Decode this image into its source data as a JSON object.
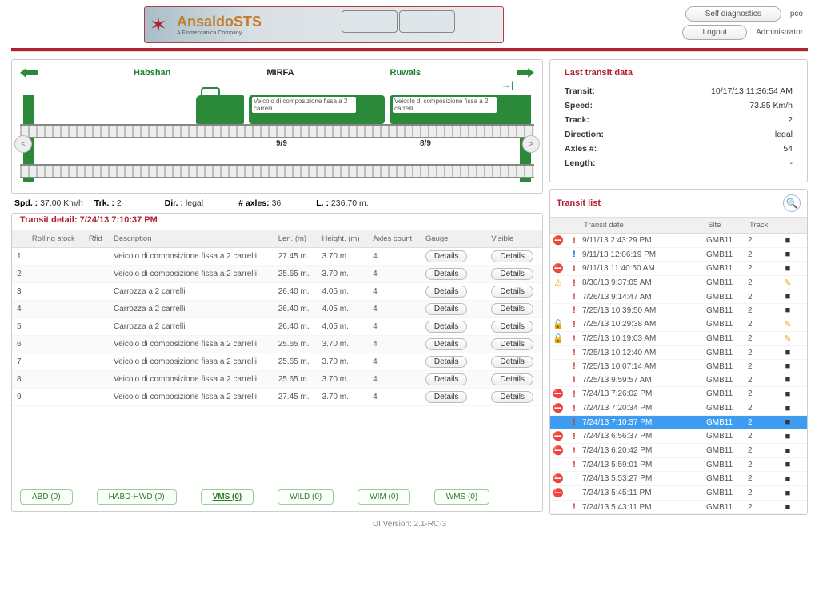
{
  "header": {
    "logo_main": "Ansaldo",
    "logo_suffix": "STS",
    "logo_sub": "A Finmeccanica Company",
    "self_diag": "Self diagnostics",
    "logout": "Logout",
    "user": "pco",
    "role": "Administrator"
  },
  "diagram": {
    "left_dest": "Habshan",
    "center": "MIRFA",
    "right_dest": "Ruwais",
    "wagon_label": "Veicolo di composizione fissa a 2 carrelli",
    "axle_a": "9/9",
    "axle_b": "8/9",
    "nav_l": "<",
    "nav_r": ">"
  },
  "summary": {
    "spd_l": "Spd. :",
    "spd_v": "37.00 Km/h",
    "trk_l": "Trk. :",
    "trk_v": "2",
    "dir_l": "Dir. :",
    "dir_v": "legal",
    "axles_l": "# axles:",
    "axles_v": "36",
    "len_l": "L. :",
    "len_v": "236.70 m."
  },
  "detail_title": "Transit detail: 7/24/13 7:10:37 PM",
  "veh_cols": [
    "",
    "Rolling stock",
    "Rfid",
    "Description",
    "Len. (m)",
    "Height. (m)",
    "Axles count",
    "Gauge",
    "",
    "Visible"
  ],
  "veh_rows": [
    {
      "n": "1",
      "desc": "Veicolo di composizione fissa a 2 carrelli",
      "len": "27.45 m.",
      "h": "3.70 m.",
      "ax": "4"
    },
    {
      "n": "2",
      "desc": "Veicolo di composizione fissa a 2 carrelli",
      "len": "25.65 m.",
      "h": "3.70 m.",
      "ax": "4"
    },
    {
      "n": "3",
      "desc": "Carrozza a 2 carrelli",
      "len": "26.40 m.",
      "h": "4.05 m.",
      "ax": "4"
    },
    {
      "n": "4",
      "desc": "Carrozza a 2 carrelli",
      "len": "26.40 m.",
      "h": "4.05 m.",
      "ax": "4"
    },
    {
      "n": "5",
      "desc": "Carrozza a 2 carrelli",
      "len": "26.40 m.",
      "h": "4.05 m.",
      "ax": "4"
    },
    {
      "n": "6",
      "desc": "Veicolo di composizione fissa a 2 carrelli",
      "len": "25.65 m.",
      "h": "3.70 m.",
      "ax": "4"
    },
    {
      "n": "7",
      "desc": "Veicolo di composizione fissa a 2 carrelli",
      "len": "25.65 m.",
      "h": "3.70 m.",
      "ax": "4"
    },
    {
      "n": "8",
      "desc": "Veicolo di composizione fissa a 2 carrelli",
      "len": "25.65 m.",
      "h": "3.70 m.",
      "ax": "4"
    },
    {
      "n": "9",
      "desc": "Veicolo di composizione fissa a 2 carrelli",
      "len": "27.45 m.",
      "h": "3.70 m.",
      "ax": "4"
    }
  ],
  "details_label": "Details",
  "tabs": [
    {
      "label": "ABD (0)"
    },
    {
      "label": "HABD-HWD (0)"
    },
    {
      "label": "VMS (0)",
      "active": true
    },
    {
      "label": "WILD (0)"
    },
    {
      "label": "WIM (0)"
    },
    {
      "label": "WMS (0)"
    }
  ],
  "version": "UI Version: 2.1-RC-3",
  "last": {
    "title": "Last transit data",
    "transit_l": "Transit:",
    "transit_v": "10/17/13 11:36:54 AM",
    "speed_l": "Speed:",
    "speed_v": "73.85 Km/h",
    "track_l": "Track:",
    "track_v": "2",
    "dir_l": "Direction:",
    "dir_v": "legal",
    "axles_l": "Axles #:",
    "axles_v": "54",
    "length_l": "Length:",
    "length_v": "-"
  },
  "tlist": {
    "title": "Transit list",
    "cols": [
      "",
      "",
      "Transit date",
      "Site",
      "Track",
      ""
    ],
    "rows": [
      {
        "i1": "err",
        "i2": "excl",
        "date": "9/11/13 2:43:29 PM",
        "site": "GMB11",
        "track": "2",
        "r": "bk"
      },
      {
        "i1": "",
        "i2": "exclb",
        "date": "9/11/13 12:06:19 PM",
        "site": "GMB11",
        "track": "2",
        "r": "bk"
      },
      {
        "i1": "err",
        "i2": "excl",
        "date": "9/11/13 11:40:50 AM",
        "site": "GMB11",
        "track": "2",
        "r": "bk"
      },
      {
        "i1": "warn",
        "i2": "excl",
        "date": "8/30/13 9:37:05 AM",
        "site": "GMB11",
        "track": "2",
        "r": "pen"
      },
      {
        "i1": "",
        "i2": "excl",
        "date": "7/26/13 9:14:47 AM",
        "site": "GMB11",
        "track": "2",
        "r": "bk"
      },
      {
        "i1": "",
        "i2": "excl",
        "date": "7/25/13 10:39:50 AM",
        "site": "GMB11",
        "track": "2",
        "r": "bk"
      },
      {
        "i1": "lock",
        "i2": "excl",
        "date": "7/25/13 10:29:38 AM",
        "site": "GMB11",
        "track": "2",
        "r": "pen"
      },
      {
        "i1": "lock",
        "i2": "excl",
        "date": "7/25/13 10:19:03 AM",
        "site": "GMB11",
        "track": "2",
        "r": "pen"
      },
      {
        "i1": "",
        "i2": "excl",
        "date": "7/25/13 10:12:40 AM",
        "site": "GMB11",
        "track": "2",
        "r": "bk"
      },
      {
        "i1": "",
        "i2": "excl",
        "date": "7/25/13 10:07:14 AM",
        "site": "GMB11",
        "track": "2",
        "r": "bk"
      },
      {
        "i1": "",
        "i2": "excl",
        "date": "7/25/13 9:59:57 AM",
        "site": "GMB11",
        "track": "2",
        "r": "bk"
      },
      {
        "i1": "err",
        "i2": "excl",
        "date": "7/24/13 7:26:02 PM",
        "site": "GMB11",
        "track": "2",
        "r": "bk"
      },
      {
        "i1": "err",
        "i2": "excl",
        "date": "7/24/13 7:20:34 PM",
        "site": "GMB11",
        "track": "2",
        "r": "bk"
      },
      {
        "i1": "",
        "i2": "excl",
        "date": "7/24/13 7:10:37 PM",
        "site": "GMB11",
        "track": "2",
        "r": "bk",
        "sel": true
      },
      {
        "i1": "err",
        "i2": "excl",
        "date": "7/24/13 6:56:37 PM",
        "site": "GMB11",
        "track": "2",
        "r": "bk"
      },
      {
        "i1": "err",
        "i2": "excl",
        "date": "7/24/13 6:20:42 PM",
        "site": "GMB11",
        "track": "2",
        "r": "bk"
      },
      {
        "i1": "",
        "i2": "excl",
        "date": "7/24/13 5:59:01 PM",
        "site": "GMB11",
        "track": "2",
        "r": "bk"
      },
      {
        "i1": "err",
        "i2": "",
        "date": "7/24/13 5:53:27 PM",
        "site": "GMB11",
        "track": "2",
        "r": "bk"
      },
      {
        "i1": "err",
        "i2": "",
        "date": "7/24/13 5:45:11 PM",
        "site": "GMB11",
        "track": "2",
        "r": "bk"
      },
      {
        "i1": "",
        "i2": "excl",
        "date": "7/24/13 5:43:11 PM",
        "site": "GMB11",
        "track": "2",
        "r": "bk"
      }
    ]
  }
}
